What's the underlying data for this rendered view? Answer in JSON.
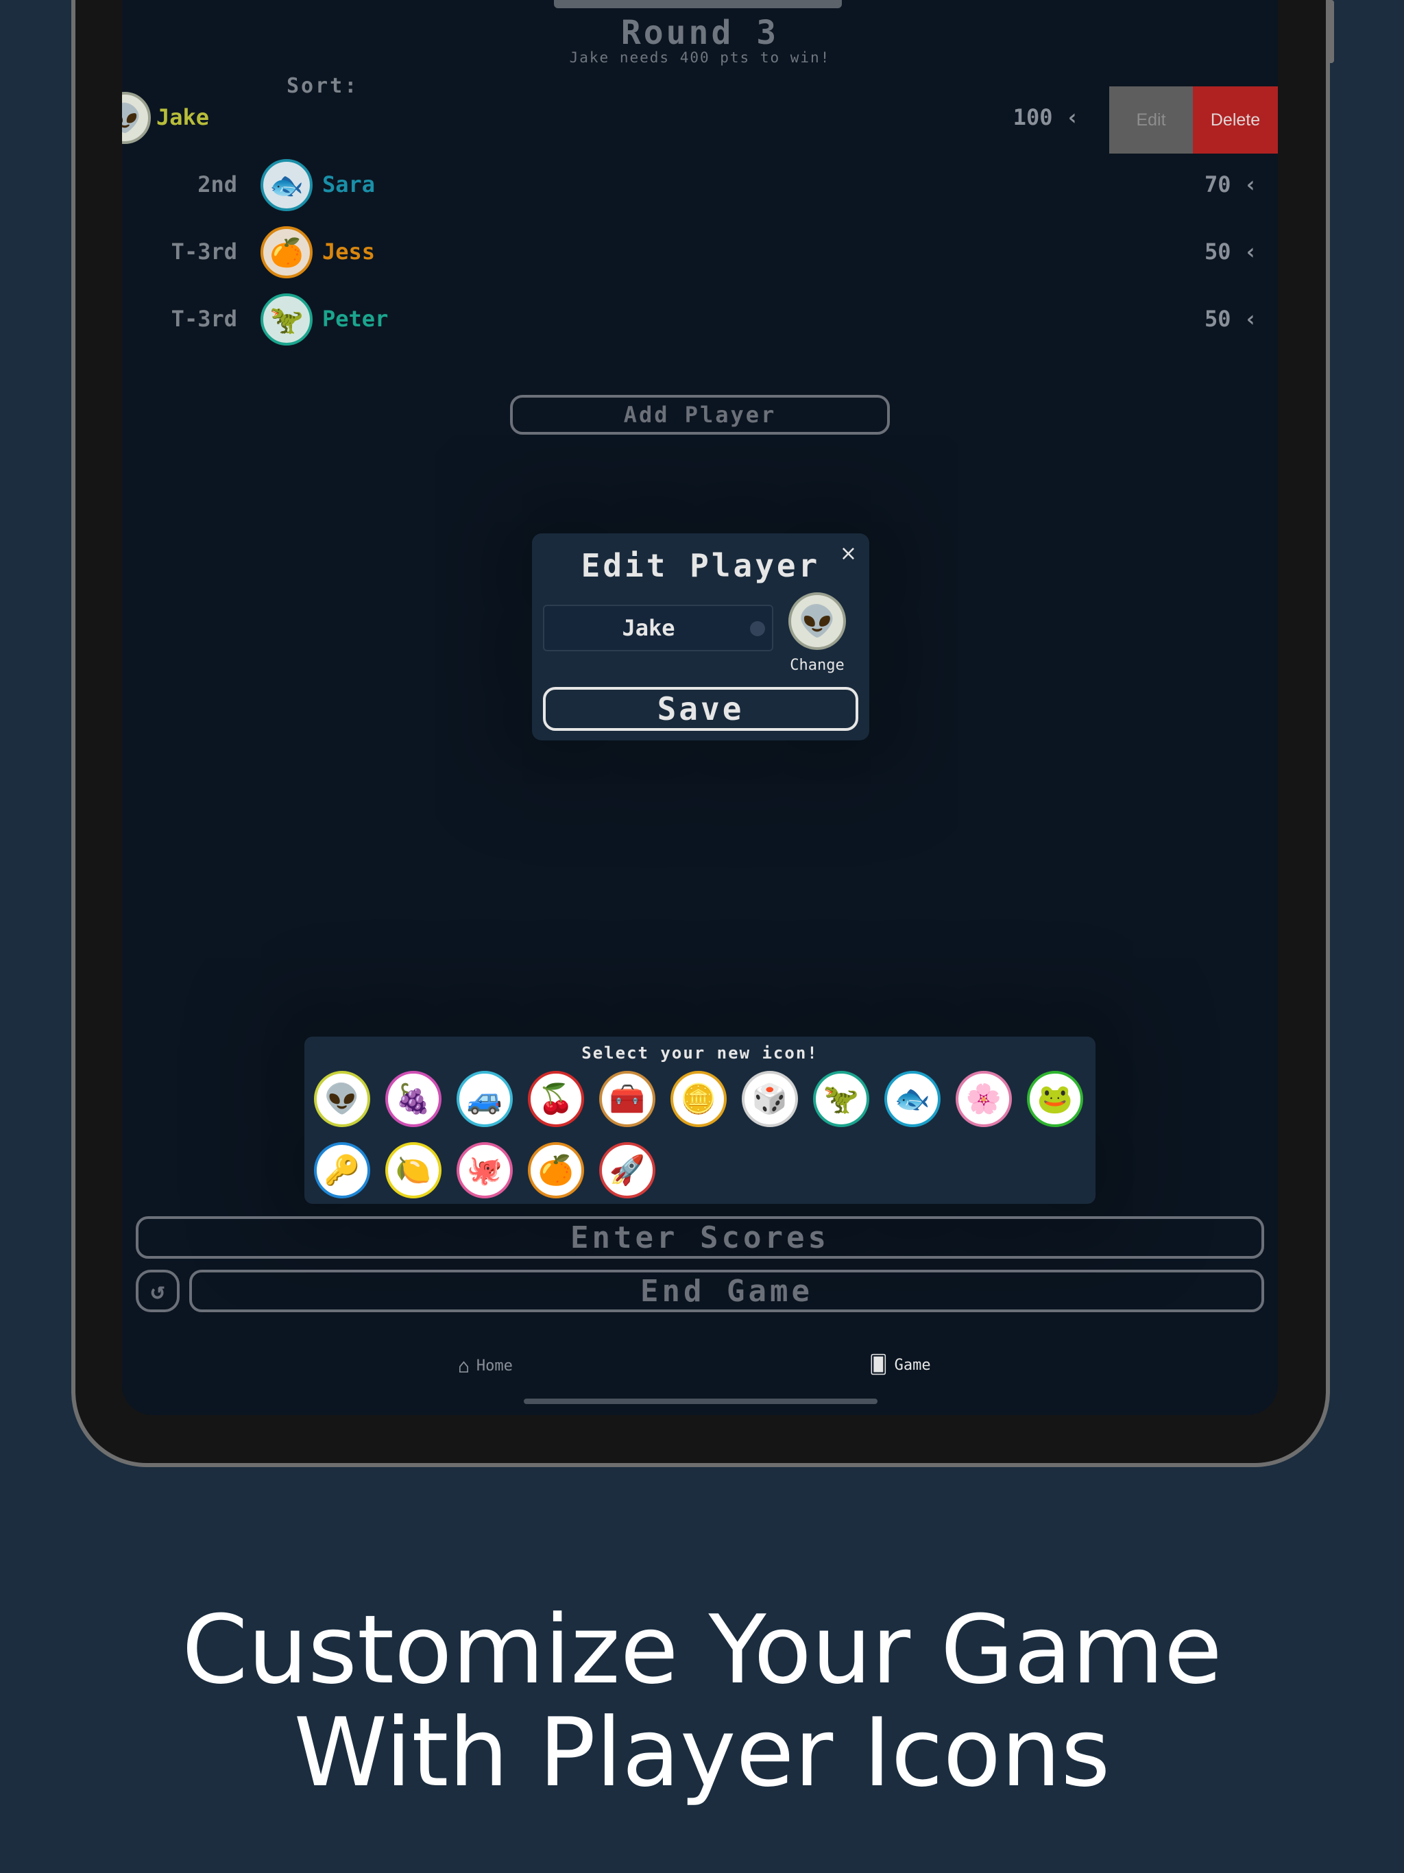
{
  "header": {
    "round": "Round 3",
    "win_note": "Jake needs 400 pts to win!",
    "sort_label": "Sort:"
  },
  "players": [
    {
      "rank": "",
      "name": "Jake",
      "score": "100 ‹",
      "icon": "alien-icon",
      "color": "#b8bd3a",
      "ring": "#9aa08f",
      "bg": "#dfe2d6"
    },
    {
      "rank": "2nd",
      "name": "Sara",
      "score": "70 ‹",
      "icon": "fish-icon",
      "color": "#1a8fa8",
      "ring": "#1a8fa8",
      "bg": "#d8e4ea"
    },
    {
      "rank": "T-3rd",
      "name": "Jess",
      "score": "50 ‹",
      "icon": "orange-icon",
      "color": "#d9860f",
      "ring": "#d9860f",
      "bg": "#e8dccf"
    },
    {
      "rank": "T-3rd",
      "name": "Peter",
      "score": "50 ‹",
      "icon": "dino-icon",
      "color": "#1ba58e",
      "ring": "#1ba58e",
      "bg": "#d4e6e2"
    }
  ],
  "swipe_actions": {
    "edit": "Edit",
    "delete": "Delete"
  },
  "add_player": "Add Player",
  "modal": {
    "title": "Edit Player",
    "close": "×",
    "name_value": "Jake",
    "change_label": "Change",
    "save_label": "Save",
    "current_icon": "alien-icon"
  },
  "picker": {
    "title": "Select your new icon!",
    "icons": [
      {
        "name": "alien-icon",
        "glyph": "👽",
        "ring": "#c8d13a"
      },
      {
        "name": "grapes-icon",
        "glyph": "🍇",
        "ring": "#cf4fb3"
      },
      {
        "name": "car-icon",
        "glyph": "🚙",
        "ring": "#3ab8d6"
      },
      {
        "name": "cherry-icon",
        "glyph": "🍒",
        "ring": "#d22a2a"
      },
      {
        "name": "treasure-chest-icon",
        "glyph": "🧰",
        "ring": "#c98a3a"
      },
      {
        "name": "coin-icon",
        "glyph": "🪙",
        "ring": "#e0a21a"
      },
      {
        "name": "dice-icon",
        "glyph": "🎲",
        "ring": "#ffffff"
      },
      {
        "name": "dino-icon",
        "glyph": "🦖",
        "ring": "#1ba58e"
      },
      {
        "name": "fish-icon",
        "glyph": "🐟",
        "ring": "#1a9fc8"
      },
      {
        "name": "flower-icon",
        "glyph": "🌸",
        "ring": "#e07aa8"
      },
      {
        "name": "frog-icon",
        "glyph": "🐸",
        "ring": "#2fb52f"
      },
      {
        "name": "key-icon",
        "glyph": "🔑",
        "ring": "#1e86d6"
      },
      {
        "name": "lemon-icon",
        "glyph": "🍋",
        "ring": "#e8d51a"
      },
      {
        "name": "octopus-icon",
        "glyph": "🐙",
        "ring": "#e05a9a"
      },
      {
        "name": "orange-icon",
        "glyph": "🍊",
        "ring": "#e0891a"
      },
      {
        "name": "rocket-icon",
        "glyph": "🚀",
        "ring": "#d23a3a"
      }
    ]
  },
  "actions": {
    "enter_scores": "Enter Scores",
    "end_game": "End Game"
  },
  "tabbar": {
    "home": "Home",
    "game": "Game"
  },
  "caption": {
    "line1": "Customize Your Game",
    "line2": "With Player Icons"
  }
}
